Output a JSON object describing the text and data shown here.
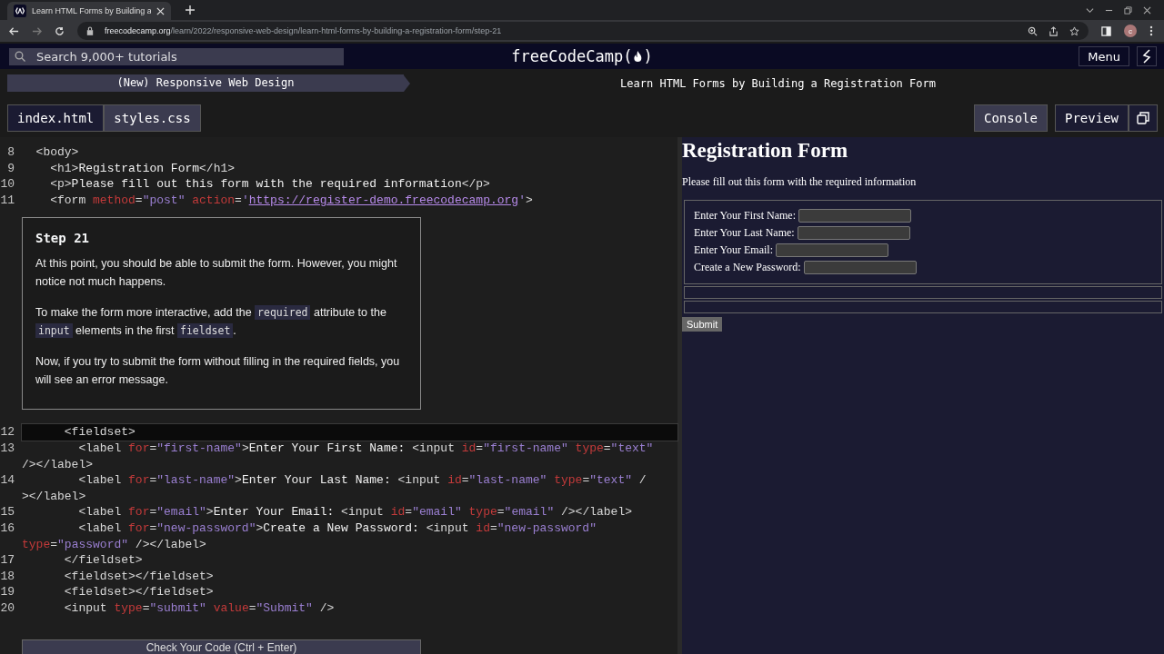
{
  "browser": {
    "tab_title": "Learn HTML Forms by Building a",
    "url_domain": "freecodecamp.org",
    "url_path": "/learn/2022/responsive-web-design/learn-html-forms-by-building-a-registration-form/step-21",
    "profile_initial": "c"
  },
  "navbar": {
    "search_placeholder": "Search 9,000+ tutorials",
    "logo_before": "freeCodeCamp(",
    "logo_after": ")",
    "menu": "Menu"
  },
  "breadcrumb": {
    "course": "(New) Responsive Web Design",
    "lesson": "Learn HTML Forms by Building a Registration Form"
  },
  "file_tabs": [
    {
      "label": "index.html",
      "selected": true
    },
    {
      "label": "styles.css",
      "selected": false
    }
  ],
  "pane_tabs": [
    {
      "label": "Console",
      "selected": false
    },
    {
      "label": "Preview",
      "selected": true
    }
  ],
  "code_top": [
    {
      "num": "8",
      "segs": [
        {
          "kind": "tag",
          "text": "  <body>"
        }
      ]
    },
    {
      "num": "9",
      "segs": [
        {
          "kind": "tag",
          "text": "    <h1>"
        },
        {
          "kind": "text",
          "text": "Registration Form"
        },
        {
          "kind": "tag",
          "text": "</h1>"
        }
      ]
    },
    {
      "num": "10",
      "segs": [
        {
          "kind": "tag",
          "text": "    <p>"
        },
        {
          "kind": "text",
          "text": "Please fill out this form with the required information"
        },
        {
          "kind": "tag",
          "text": "</p>"
        }
      ]
    },
    {
      "num": "11",
      "segs": [
        {
          "kind": "tag",
          "text": "    <form "
        },
        {
          "kind": "attr",
          "text": "method"
        },
        {
          "kind": "tag",
          "text": "="
        },
        {
          "kind": "str",
          "text": "\"post\" "
        },
        {
          "kind": "attr",
          "text": "action"
        },
        {
          "kind": "tag",
          "text": "="
        },
        {
          "kind": "str",
          "text": "'"
        },
        {
          "kind": "url",
          "text": "https://register-demo.freecodecamp.org"
        },
        {
          "kind": "str",
          "text": "'"
        },
        {
          "kind": "tag",
          "text": ">"
        }
      ]
    }
  ],
  "step": {
    "title": "Step 21",
    "paragraphs": [
      [
        {
          "kind": "prose",
          "text": "At this point, you should be able to submit the form. However, you might notice not much happens."
        }
      ],
      [
        {
          "kind": "prose",
          "text": "To make the form more interactive, add the "
        },
        {
          "kind": "code",
          "text": "required"
        },
        {
          "kind": "prose",
          "text": " attribute to the "
        },
        {
          "kind": "code",
          "text": "input"
        },
        {
          "kind": "prose",
          "text": " elements in the first "
        },
        {
          "kind": "code",
          "text": "fieldset"
        },
        {
          "kind": "prose",
          "text": "."
        }
      ],
      [
        {
          "kind": "prose",
          "text": "Now, if you try to submit the form without filling in the required fields, you will see an error message."
        }
      ]
    ]
  },
  "code_bottom": [
    {
      "num": "12",
      "current": true,
      "segs": [
        {
          "kind": "tag",
          "text": "      <fieldset>"
        }
      ]
    },
    {
      "num": "13",
      "current": false,
      "segs": [
        {
          "kind": "tag",
          "text": "        <label "
        },
        {
          "kind": "attr",
          "text": "for"
        },
        {
          "kind": "tag",
          "text": "="
        },
        {
          "kind": "str",
          "text": "\"first-name\""
        },
        {
          "kind": "tag",
          "text": ">"
        },
        {
          "kind": "text",
          "text": "Enter Your First Name: "
        },
        {
          "kind": "tag",
          "text": "<input "
        },
        {
          "kind": "attr",
          "text": "id"
        },
        {
          "kind": "tag",
          "text": "="
        },
        {
          "kind": "str",
          "text": "\"first-name\" "
        },
        {
          "kind": "attr",
          "text": "type"
        },
        {
          "kind": "tag",
          "text": "="
        },
        {
          "kind": "str",
          "text": "\"text\""
        }
      ]
    },
    {
      "current": false,
      "segs": [
        {
          "kind": "tag",
          "text": "/></label>"
        }
      ]
    },
    {
      "num": "14",
      "current": false,
      "segs": [
        {
          "kind": "tag",
          "text": "        <label "
        },
        {
          "kind": "attr",
          "text": "for"
        },
        {
          "kind": "tag",
          "text": "="
        },
        {
          "kind": "str",
          "text": "\"last-name\""
        },
        {
          "kind": "tag",
          "text": ">"
        },
        {
          "kind": "text",
          "text": "Enter Your Last Name: "
        },
        {
          "kind": "tag",
          "text": "<input "
        },
        {
          "kind": "attr",
          "text": "id"
        },
        {
          "kind": "tag",
          "text": "="
        },
        {
          "kind": "str",
          "text": "\"last-name\" "
        },
        {
          "kind": "attr",
          "text": "type"
        },
        {
          "kind": "tag",
          "text": "="
        },
        {
          "kind": "str",
          "text": "\"text\" "
        },
        {
          "kind": "tag",
          "text": "/"
        }
      ]
    },
    {
      "current": false,
      "segs": [
        {
          "kind": "tag",
          "text": "></label>"
        }
      ]
    },
    {
      "num": "15",
      "current": false,
      "segs": [
        {
          "kind": "tag",
          "text": "        <label "
        },
        {
          "kind": "attr",
          "text": "for"
        },
        {
          "kind": "tag",
          "text": "="
        },
        {
          "kind": "str",
          "text": "\"email\""
        },
        {
          "kind": "tag",
          "text": ">"
        },
        {
          "kind": "text",
          "text": "Enter Your Email: "
        },
        {
          "kind": "tag",
          "text": "<input "
        },
        {
          "kind": "attr",
          "text": "id"
        },
        {
          "kind": "tag",
          "text": "="
        },
        {
          "kind": "str",
          "text": "\"email\" "
        },
        {
          "kind": "attr",
          "text": "type"
        },
        {
          "kind": "tag",
          "text": "="
        },
        {
          "kind": "str",
          "text": "\"email\" "
        },
        {
          "kind": "tag",
          "text": "/></label>"
        }
      ]
    },
    {
      "num": "16",
      "current": false,
      "segs": [
        {
          "kind": "tag",
          "text": "        <label "
        },
        {
          "kind": "attr",
          "text": "for"
        },
        {
          "kind": "tag",
          "text": "="
        },
        {
          "kind": "str",
          "text": "\"new-password\""
        },
        {
          "kind": "tag",
          "text": ">"
        },
        {
          "kind": "text",
          "text": "Create a New Password: "
        },
        {
          "kind": "tag",
          "text": "<input "
        },
        {
          "kind": "attr",
          "text": "id"
        },
        {
          "kind": "tag",
          "text": "="
        },
        {
          "kind": "str",
          "text": "\"new-password\""
        }
      ]
    },
    {
      "current": false,
      "segs": [
        {
          "kind": "attr",
          "text": "type"
        },
        {
          "kind": "tag",
          "text": "="
        },
        {
          "kind": "str",
          "text": "\"password\" "
        },
        {
          "kind": "tag",
          "text": "/></label>"
        }
      ]
    },
    {
      "num": "17",
      "current": false,
      "segs": [
        {
          "kind": "tag",
          "text": "      </fieldset>"
        }
      ]
    },
    {
      "num": "18",
      "current": false,
      "segs": [
        {
          "kind": "tag",
          "text": "      <fieldset></fieldset>"
        }
      ]
    },
    {
      "num": "19",
      "current": false,
      "segs": [
        {
          "kind": "tag",
          "text": "      <fieldset></fieldset>"
        }
      ]
    },
    {
      "num": "20",
      "current": false,
      "segs": [
        {
          "kind": "tag",
          "text": "      <input "
        },
        {
          "kind": "attr",
          "text": "type"
        },
        {
          "kind": "tag",
          "text": "="
        },
        {
          "kind": "str",
          "text": "\"submit\" "
        },
        {
          "kind": "attr",
          "text": "value"
        },
        {
          "kind": "tag",
          "text": "="
        },
        {
          "kind": "str",
          "text": "\"Submit\" "
        },
        {
          "kind": "tag",
          "text": "/>"
        }
      ]
    }
  ],
  "check_button": "Check Your Code (Ctrl + Enter)",
  "preview": {
    "heading": "Registration Form",
    "intro": "Please fill out this form with the required information",
    "fields": [
      "Enter Your First Name:",
      "Enter Your Last Name:",
      "Enter Your Email:",
      "Create a New Password:"
    ],
    "submit": "Submit"
  }
}
